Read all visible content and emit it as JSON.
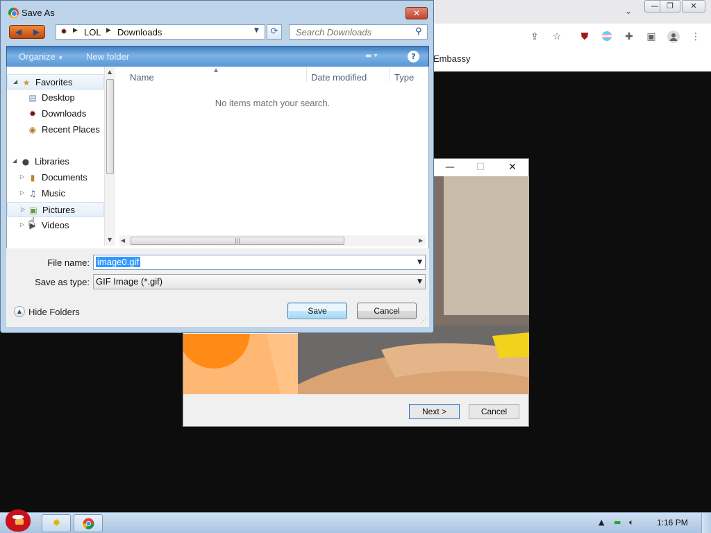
{
  "browser": {
    "bookmark_text": "Embassy",
    "toolbar_icons": [
      "share-icon",
      "star-icon",
      "ublock-icon",
      "extension-flag-icon",
      "puzzle-icon",
      "sidepanel-icon",
      "profile-icon",
      "menu-icon"
    ]
  },
  "installer": {
    "next_label": "Next >",
    "cancel_label": "Cancel"
  },
  "save_dialog": {
    "title": "Save As",
    "breadcrumb": [
      "LOL",
      "Downloads"
    ],
    "search_placeholder": "Search Downloads",
    "commands": {
      "organize": "Organize",
      "new_folder": "New folder"
    },
    "nav": {
      "favorites": "Favorites",
      "desktop": "Desktop",
      "downloads": "Downloads",
      "recent_places": "Recent Places",
      "libraries": "Libraries",
      "documents": "Documents",
      "music": "Music",
      "pictures": "Pictures",
      "videos": "Videos"
    },
    "columns": [
      "Name",
      "Date modified",
      "Type"
    ],
    "empty_message": "No items match your search.",
    "file_name_label": "File name:",
    "file_name_value": "image0.gif",
    "save_type_label": "Save as type:",
    "save_type_value": "GIF Image (*.gif)",
    "hide_folders": "Hide Folders",
    "save_label": "Save",
    "cancel_label": "Cancel"
  },
  "taskbar": {
    "clock": "1:16 PM"
  },
  "colors": {
    "accent_selection": "#3399ff",
    "command_bar": "#5797d6",
    "installer_orange": "#ffb873",
    "toy_red": "#e8321e"
  }
}
